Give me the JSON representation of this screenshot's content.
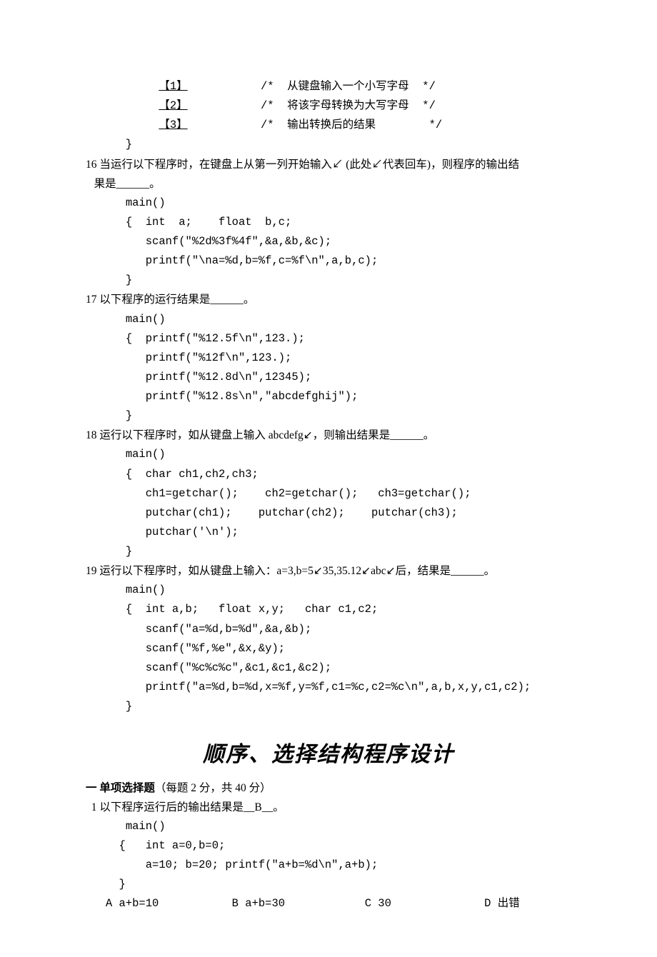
{
  "blanks": {
    "b1": {
      "label": "【1】",
      "comment": "/*  从键盘输入一个小写字母  */"
    },
    "b2": {
      "label": "【2】",
      "comment": "/*  将该字母转换为大写字母  */"
    },
    "b3": {
      "label": "【3】",
      "comment": "/*  输出转换后的结果        */"
    }
  },
  "q16": {
    "num": "16",
    "stem1": "当运行以下程序时，在键盘上从第一列开始输入↙ (此处↙代表回车)，则程序的输出结",
    "stem2": "果是______。",
    "l1": "main()",
    "l2": "{  int  a;    float  b,c;",
    "l3": "   scanf(\"%2d%3f%4f\",&a,&b,&c);",
    "l4": "   printf(\"\\na=%d,b=%f,c=%f\\n\",a,b,c);",
    "l5": "}"
  },
  "q17": {
    "num": "17",
    "stem": "以下程序的运行结果是______。",
    "l1": "main()",
    "l2": "{  printf(\"%12.5f\\n\",123.);",
    "l3": "   printf(\"%12f\\n\",123.);",
    "l4": "   printf(\"%12.8d\\n\",12345);",
    "l5": "   printf(\"%12.8s\\n\",\"abcdefghij\");",
    "l6": "}"
  },
  "q18": {
    "num": "18",
    "stem": "运行以下程序时，如从键盘上输入 abcdefg↙，则输出结果是______。",
    "l1": "main()",
    "l2": "{  char ch1,ch2,ch3;",
    "l3": "   ch1=getchar();    ch2=getchar();   ch3=getchar();",
    "l4": "   putchar(ch1);    putchar(ch2);    putchar(ch3);",
    "l5": "   putchar('\\n');",
    "l6": "}"
  },
  "q19": {
    "num": "19",
    "stem": "运行以下程序时，如从键盘上输入：a=3,b=5↙35,35.12↙abc↙后，结果是______。",
    "l1": "main()",
    "l2": "{  int a,b;   float x,y;   char c1,c2;",
    "l3": "   scanf(\"a=%d,b=%d\",&a,&b);",
    "l4": "   scanf(\"%f,%e\",&x,&y);",
    "l5": "   scanf(\"%c%c%c\",&c1,&c1,&c2);",
    "l6": "   printf(\"a=%d,b=%d,x=%f,y=%f,c1=%c,c2=%c\\n\",a,b,x,y,c1,c2);",
    "l7": "}"
  },
  "title": "顺序、选择结构程序设计",
  "section": {
    "label": "一 单项选择题",
    "paren": "（每题 2 分，共 40 分）"
  },
  "mc1": {
    "num": "1",
    "stem": "以下程序运行后的输出结果是__B__。",
    "l1": "main()",
    "l2": "{   int a=0,b=0;",
    "l3": "   a=10; b=20; printf(\"a+b=%d\\n\",a+b);",
    "l4": "}",
    "optA": "A a+b=10",
    "optB": "B a+b=30",
    "optC": "C 30",
    "optD": "D 出错"
  }
}
